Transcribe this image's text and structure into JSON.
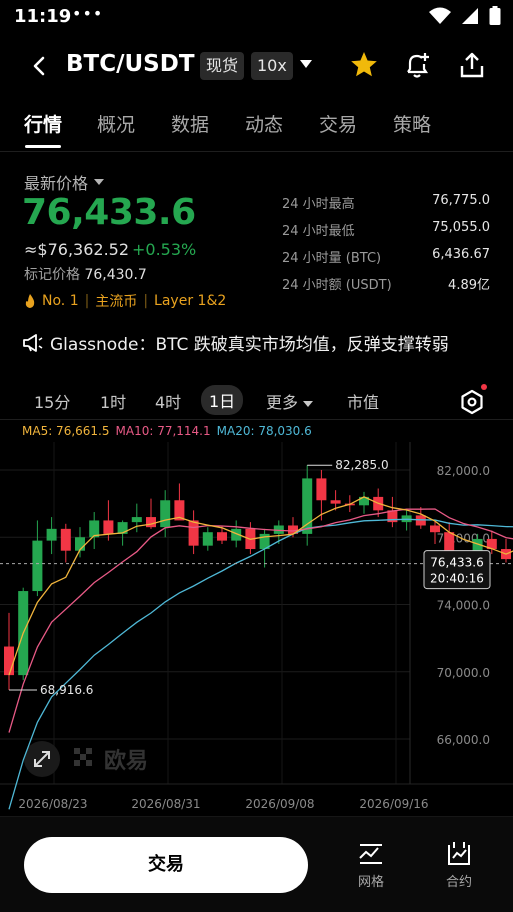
{
  "status": {
    "time": "11:19",
    "dots": "•••"
  },
  "header": {
    "pair": "BTC/USDT",
    "spot_tag": "现货",
    "leverage_tag": "10x"
  },
  "tabs": [
    "行情",
    "概况",
    "数据",
    "动态",
    "交易",
    "策略"
  ],
  "quote": {
    "label": "最新价格",
    "price": "76,433.6",
    "usd_value": "≈$76,362.52",
    "change": "+0.53%",
    "mark_label": "标记价格",
    "mark_price": "76,430.7",
    "rank": "No. 1",
    "tag1": "主流币",
    "tag2": "Layer 1&2"
  },
  "stats": [
    {
      "label": "24 小时最高",
      "value": "76,775.0"
    },
    {
      "label": "24 小时最低",
      "value": "75,055.0"
    },
    {
      "label": "24 小时量 (BTC)",
      "value": "6,436.67"
    },
    {
      "label": "24 小时额 (USDT)",
      "value": "4.89亿"
    }
  ],
  "news": "Glassnode：BTC 跌破真实市场均值，反弹支撑转弱",
  "intervals": [
    "15分",
    "1时",
    "4时",
    "1日",
    "更多",
    "市值"
  ],
  "active_interval": "1日",
  "ma": {
    "ma5": "MA5: 76,661.5",
    "ma10": "MA10: 77,114.1",
    "ma20": "MA20: 78,030.6"
  },
  "colors": {
    "up": "#25a750",
    "down": "#f23645",
    "ma5": "#f0b43c",
    "ma10": "#e85a86",
    "ma20": "#4fb8d6"
  },
  "chart_data": {
    "type": "candlestick",
    "y_axis_ticks": [
      "82,000.0",
      "78,000.0",
      "74,000.0",
      "70,000.0",
      "66,000.0"
    ],
    "y_axis_values": [
      82000,
      78000,
      74000,
      70000,
      66000
    ],
    "x_axis_labels": [
      "2026/08/23",
      "2026/08/31",
      "2026/09/08",
      "2026/09/16"
    ],
    "high_label": "82,285.0",
    "low_label": "68,916.6",
    "current_price": "76,433.6",
    "countdown": "20:40:16",
    "watermark": "欧易",
    "candles": [
      [
        71500,
        73500,
        68916.6,
        69800
      ],
      [
        69800,
        75000,
        69500,
        74800
      ],
      [
        74800,
        79000,
        74500,
        77800
      ],
      [
        77800,
        79200,
        77000,
        78500
      ],
      [
        78500,
        78800,
        76500,
        77200
      ],
      [
        77200,
        78600,
        76800,
        78000
      ],
      [
        78000,
        79500,
        77300,
        79000
      ],
      [
        79000,
        80200,
        77800,
        78200
      ],
      [
        78200,
        79000,
        77500,
        78900
      ],
      [
        78900,
        80000,
        78300,
        79200
      ],
      [
        79200,
        80300,
        78500,
        78600
      ],
      [
        78600,
        80800,
        78000,
        80200
      ],
      [
        80200,
        81200,
        79500,
        79000
      ],
      [
        79000,
        79600,
        77000,
        77500
      ],
      [
        77500,
        78600,
        77200,
        78300
      ],
      [
        78300,
        78700,
        77600,
        77800
      ],
      [
        77800,
        79000,
        77400,
        78500
      ],
      [
        78500,
        78900,
        77000,
        77300
      ],
      [
        77300,
        78500,
        76200,
        78200
      ],
      [
        78200,
        79000,
        77600,
        78700
      ],
      [
        78700,
        79200,
        78000,
        78200
      ],
      [
        78200,
        82285,
        77500,
        81500
      ],
      [
        81500,
        82000,
        79000,
        80200
      ],
      [
        80200,
        80800,
        79600,
        80000
      ],
      [
        80000,
        80500,
        79500,
        79900
      ],
      [
        79900,
        80700,
        79400,
        80400
      ],
      [
        80400,
        80900,
        79200,
        79600
      ],
      [
        79600,
        80400,
        78600,
        78900
      ],
      [
        78900,
        79700,
        78400,
        79300
      ],
      [
        79300,
        79800,
        78500,
        78700
      ],
      [
        78700,
        79000,
        77600,
        78300
      ],
      [
        78300,
        78900,
        76000,
        76300
      ],
      [
        76300,
        77200,
        75700,
        76800
      ],
      [
        76800,
        78200,
        76400,
        77900
      ],
      [
        77900,
        78400,
        77000,
        77300
      ],
      [
        77300,
        77900,
        76500,
        76700
      ],
      [
        76700,
        78300,
        76400,
        78100
      ],
      [
        78100,
        79200,
        77300,
        77600
      ],
      [
        77600,
        77900,
        74800,
        75300
      ],
      [
        75300,
        76900,
        75100,
        76300
      ],
      [
        76300,
        76775,
        75055,
        76433.6
      ]
    ]
  },
  "bottom": {
    "trade": "交易",
    "grid": "网格",
    "contract": "合约"
  }
}
